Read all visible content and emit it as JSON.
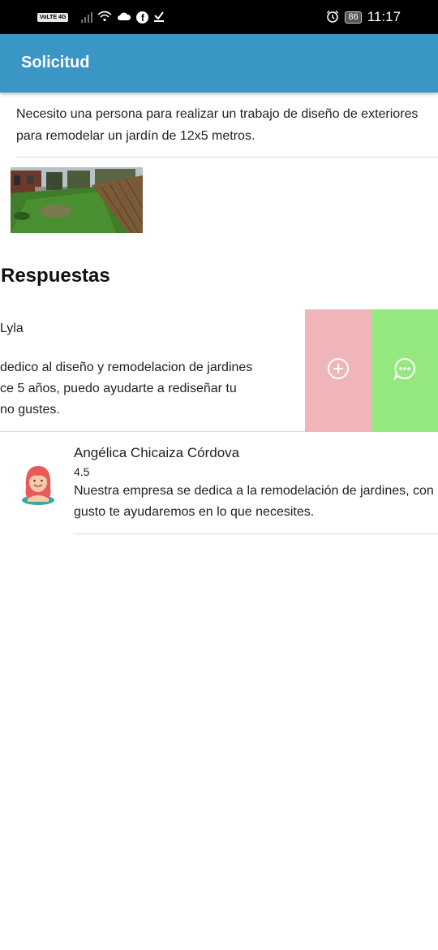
{
  "status_bar": {
    "network_badge": "VoLTE 4G",
    "battery": "86",
    "time": "11:17",
    "icons": [
      "signal-icon",
      "wifi-icon",
      "cloud-icon",
      "facebook-icon",
      "download-check-icon",
      "alarm-icon",
      "battery-icon"
    ]
  },
  "app_bar": {
    "title": "Solicitud",
    "color": "#3a96c4"
  },
  "request": {
    "description": "Necesito una persona para realizar un trabajo de diseño de exteriores para remodelar un jardín de 12x5 metros.",
    "image": "garden-photo"
  },
  "responses_section": {
    "title": "Respuestas"
  },
  "responses": [
    {
      "name": "Lyla",
      "message": "dedico al diseño y remodelacion de jardines\nce 5 años, puedo ayudarte a rediseñar tu\nno gustes.",
      "actions": [
        {
          "icon": "add-circle-icon",
          "color": "#efb5b9"
        },
        {
          "icon": "chat-bubble-icon",
          "color": "#94e87f"
        }
      ]
    },
    {
      "name": "Angélica Chicaiza Córdova",
      "rating": "4.5",
      "message": "Nuestra empresa se dedica a la remodelación de jardines, con gusto te ayudaremos en lo que necesites.",
      "avatar": "avatar-icon"
    }
  ]
}
